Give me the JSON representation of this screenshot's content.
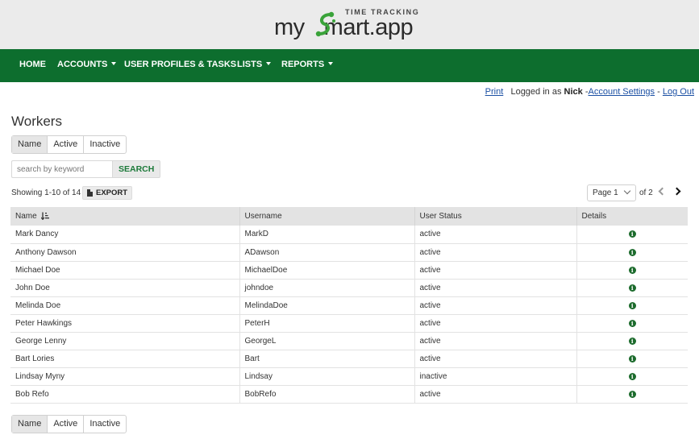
{
  "logo": {
    "tagline": "TIME TRACKING",
    "word_left": "my",
    "word_right": "mart.app"
  },
  "nav": [
    {
      "label": "HOME",
      "dropdown": false
    },
    {
      "label": "ACCOUNTS",
      "dropdown": true
    },
    {
      "label": "USER PROFILES & TASKS",
      "dropdown": false
    },
    {
      "label": "LISTS",
      "dropdown": true
    },
    {
      "label": "REPORTS",
      "dropdown": true
    }
  ],
  "userbar": {
    "print": "Print",
    "logged_in_as": "Logged in as",
    "username": "Nick",
    "sep1": "-",
    "account_settings": "Account Settings",
    "sep2": "-",
    "logout": "Log Out"
  },
  "page": {
    "title": "Workers"
  },
  "sort_tabs": {
    "items": [
      "Name",
      "Active",
      "Inactive"
    ],
    "active": "Name"
  },
  "search": {
    "placeholder": "search by keyword",
    "button": "SEARCH"
  },
  "listing": {
    "showing": "Showing 1-10 of 14",
    "export": "EXPORT"
  },
  "pager": {
    "current": "Page 1",
    "of": "of 2"
  },
  "table": {
    "headers": [
      "Name",
      "Username",
      "User Status",
      "Details"
    ],
    "rows": [
      {
        "name": "Mark Dancy",
        "username": "MarkD",
        "status": "active"
      },
      {
        "name": "Anthony Dawson",
        "username": "ADawson",
        "status": "active"
      },
      {
        "name": "Michael Doe",
        "username": "MichaelDoe",
        "status": "active"
      },
      {
        "name": "John Doe",
        "username": "johndoe",
        "status": "active"
      },
      {
        "name": "Melinda Doe",
        "username": "MelindaDoe",
        "status": "active"
      },
      {
        "name": "Peter Hawkings",
        "username": "PeterH",
        "status": "active"
      },
      {
        "name": "George Lenny",
        "username": "GeorgeL",
        "status": "active"
      },
      {
        "name": "Bart Lories",
        "username": "Bart",
        "status": "active"
      },
      {
        "name": "Lindsay Myny",
        "username": "Lindsay",
        "status": "inactive"
      },
      {
        "name": "Bob Refo",
        "username": "BobRefo",
        "status": "active"
      }
    ],
    "details_icon": "info-icon"
  },
  "colors": {
    "nav_bg": "#0d6e2e",
    "accent_green": "#1d7a3a",
    "logo_green": "#3aa33a"
  }
}
